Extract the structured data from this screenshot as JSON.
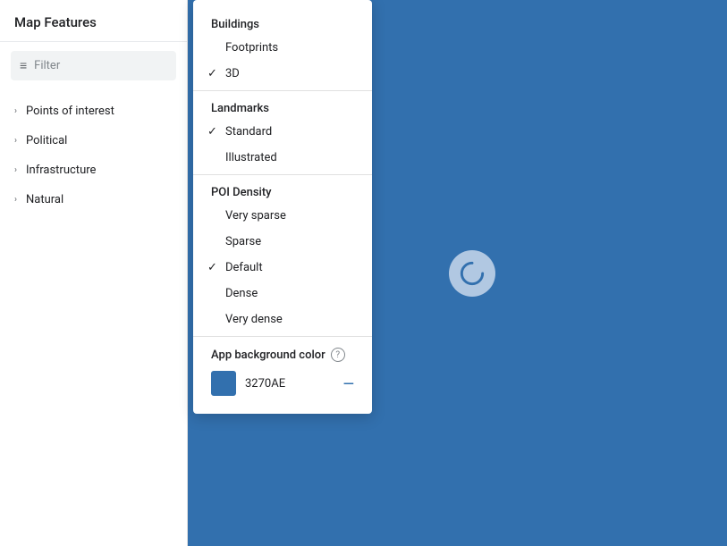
{
  "sidebar": {
    "title": "Map Features",
    "filter_placeholder": "Filter",
    "items": [
      {
        "label": "Points of interest"
      },
      {
        "label": "Political"
      },
      {
        "label": "Infrastructure"
      },
      {
        "label": "Natural"
      }
    ]
  },
  "dropdown": {
    "sections": [
      {
        "label": "Buildings",
        "items": [
          {
            "label": "Footprints",
            "checked": false
          },
          {
            "label": "3D",
            "checked": true
          }
        ]
      },
      {
        "label": "Landmarks",
        "items": [
          {
            "label": "Standard",
            "checked": true
          },
          {
            "label": "Illustrated",
            "checked": false
          }
        ]
      },
      {
        "label": "POI Density",
        "items": [
          {
            "label": "Very sparse",
            "checked": false
          },
          {
            "label": "Sparse",
            "checked": false
          },
          {
            "label": "Default",
            "checked": true
          },
          {
            "label": "Dense",
            "checked": false
          },
          {
            "label": "Very dense",
            "checked": false
          }
        ]
      }
    ],
    "app_bg": {
      "label": "App background color",
      "help_icon": "?",
      "color_value": "3270AE",
      "minus_label": "—"
    }
  },
  "map": {
    "bg_color": "#3270AE",
    "spinner_label": "C"
  },
  "icons": {
    "gear": "gear-icon",
    "filter_lines": "≡",
    "chevron_right": "›",
    "check": "✓"
  }
}
